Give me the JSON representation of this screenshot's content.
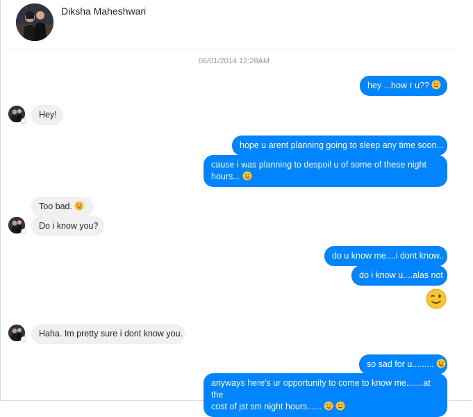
{
  "header": {
    "contact_name": "Diksha Maheshwari"
  },
  "timestamp": "06/01/2014 12:28AM",
  "messages": {
    "m1": "hey ...how r u??",
    "m2": "Hey!",
    "m3": "hope u arent planning going to sleep any time soon...",
    "m4a": "cause i was planning to despoil u of some of these night",
    "m4b": "hours...",
    "m5": "Too bad.",
    "m6": "Do i know you?",
    "m7": "do u know me....i dont know..",
    "m8": "do i know u....alas not",
    "m10": "Haha. Im pretty sure i dont know you.",
    "m11": "so sad for u.........",
    "m12a": "anyways here's ur opportunity to come to know me.......at the",
    "m12b": "cost of jst sm night hours......"
  },
  "colors": {
    "outgoing": "#0084ff",
    "incoming": "#f1f0f0",
    "emoji": "#f7c531"
  },
  "icons": [
    "smile-icon",
    "tongue-out-icon",
    "wink-icon",
    "facebook-badge-icon"
  ]
}
